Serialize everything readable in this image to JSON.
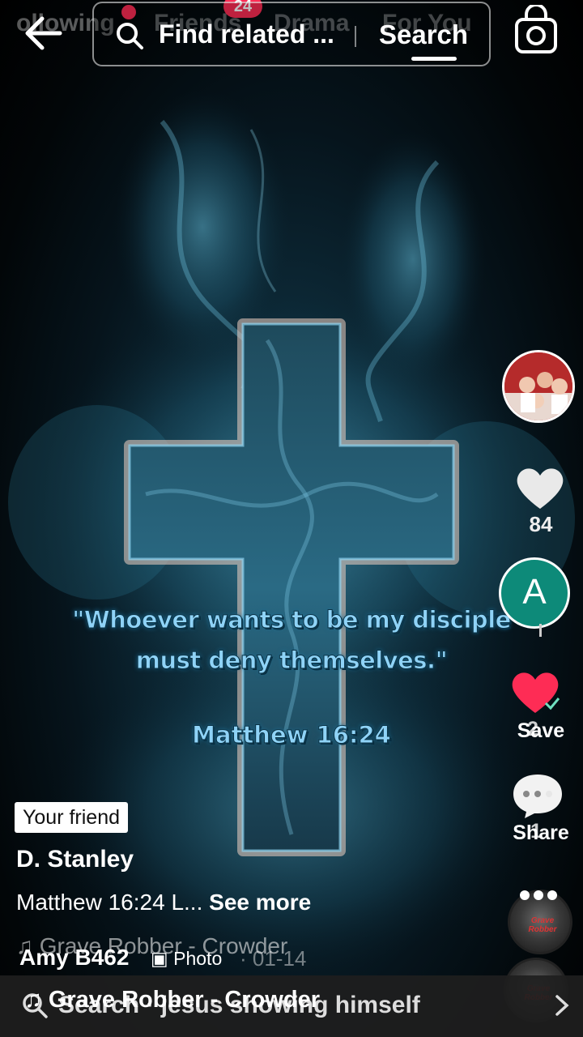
{
  "top_bar": {
    "tabs": [
      "ollowing",
      "Friends",
      "Drama",
      "For You"
    ],
    "friends_badge": "24",
    "search_text": "Find related ...",
    "search_button": "Search"
  },
  "post": {
    "quote_line1": "\"Whoever wants to be my disciple",
    "quote_line2": "must deny themselves.\"",
    "verse_reference": "Matthew 16:24"
  },
  "actions": {
    "like_count": "84",
    "profile_initial": "A",
    "save_label": "Save",
    "save_count": "2",
    "share_label": "Share",
    "share_count": "1",
    "disc_label": "Grave Robber"
  },
  "info": {
    "friend_badge": "Your friend",
    "author": "D. Stanley",
    "caption": "Matthew 16:24  L...",
    "see_more": "See more",
    "music": "Grave Robber - Crowder",
    "overlay_author": "Amy B462",
    "photo_tag": "Photo",
    "date": "· 01-14"
  },
  "bottom_bar": {
    "search_text": "Search · jesus showing himself",
    "music_text": "Grave Robber - Crowder"
  },
  "colors": {
    "accent_red": "#fe2c55",
    "profile_green": "#0d8a79",
    "quote_blue": "#8fd3f7"
  }
}
